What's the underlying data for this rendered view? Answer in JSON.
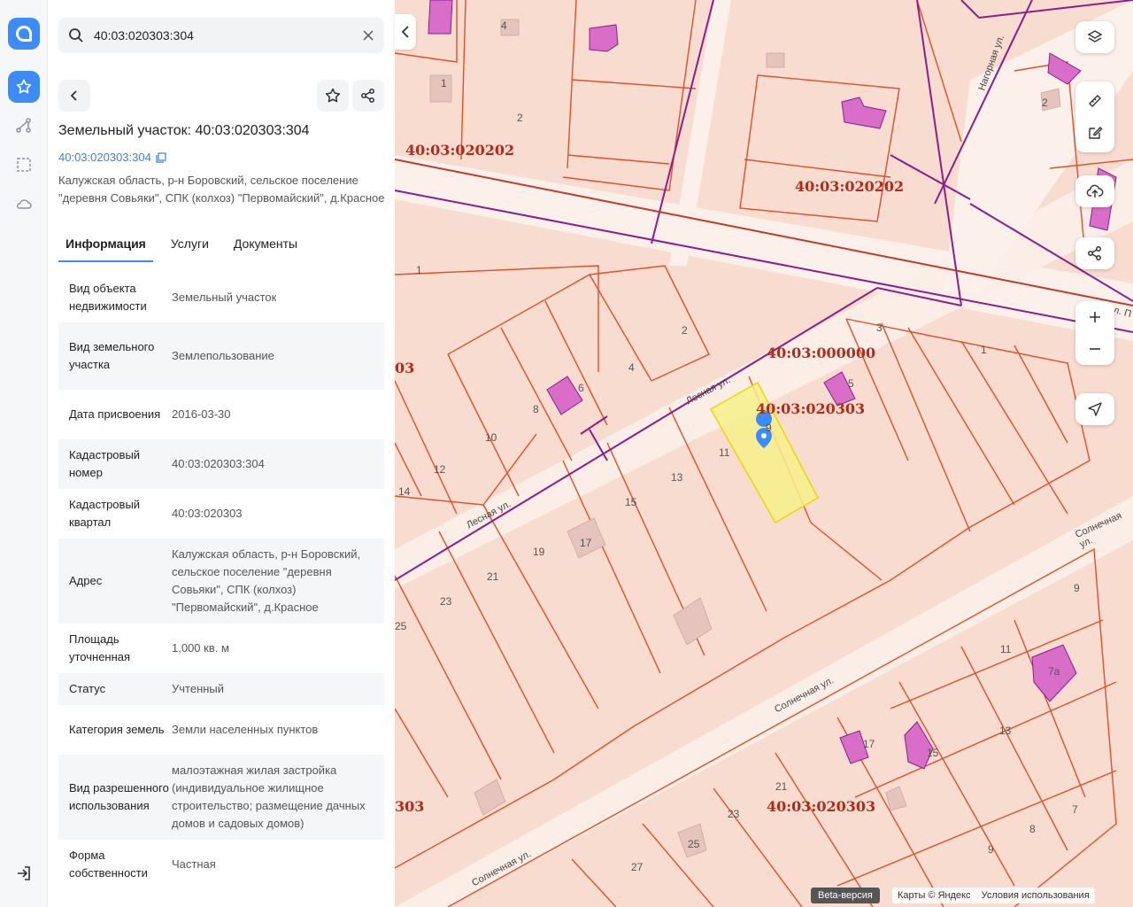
{
  "search": {
    "value": "40:03:020303:304"
  },
  "object": {
    "title": "Земельный участок: 40:03:020303:304",
    "cad_link": "40:03:020303:304",
    "address": "Калужская область, р-н Боровский, сельское поселение \"деревня Совьяки\", СПК (колхоз) \"Первомайский\", д.Красное"
  },
  "tabs": [
    "Информация",
    "Услуги",
    "Документы"
  ],
  "info": [
    {
      "k": "Вид объекта недвижимости",
      "v": "Земельный участок"
    },
    {
      "k": "Вид земельного участка",
      "v": "Землепользование"
    },
    {
      "k": "Дата присвоения",
      "v": "2016-03-30"
    },
    {
      "k": "Кадастровый номер",
      "v": "40:03:020303:304"
    },
    {
      "k": "Кадастровый квартал",
      "v": "40:03:020303"
    },
    {
      "k": "Адрес",
      "v": "Калужская область, р-н Боровский, сельское поселение \"деревня Совьяки\", СПК (колхоз) \"Первомайский\", д.Красное"
    },
    {
      "k": "Площадь уточненная",
      "v": "1,000 кв. м"
    },
    {
      "k": "Статус",
      "v": "Учтенный"
    },
    {
      "k": "Категория земель",
      "v": "Земли населенных пунктов"
    },
    {
      "k": "Вид разрешенного использования",
      "v": "малоэтажная жилая застройка (индивидуальное жилищное строительство; размещение дачных домов и садовых домов)"
    },
    {
      "k": "Форма собственности",
      "v": "Частная"
    }
  ],
  "map": {
    "quarter_labels": [
      "40:03:020202",
      "40:03:020202",
      "40:03:000000",
      "40:03:020303",
      "40:03:020303",
      "03",
      "303"
    ],
    "streets": [
      "Нагорная ул.",
      "Лесная ул.",
      "Лесная ул.",
      "Солнечная ул.",
      "Солнечная ул.",
      "Солнечная ул.",
      "л. П"
    ],
    "plot_numbers": [
      "4",
      "1",
      "2",
      "2",
      "1",
      "3",
      "1",
      "2",
      "4",
      "6",
      "8",
      "10",
      "12",
      "14",
      "5",
      "9",
      "11",
      "13",
      "15",
      "17",
      "19",
      "21",
      "23",
      "25",
      "27",
      "9",
      "11",
      "13",
      "7",
      "8",
      "9",
      "17",
      "15",
      "21",
      "23",
      "25",
      "7а"
    ],
    "footer": {
      "beta": "Beta-версия",
      "copyright": "Карты © Яндекс",
      "terms": "Условия использования"
    }
  },
  "colors": {
    "accent": "#3d8bf7",
    "selected_plot": "#f7f08a",
    "parcel_border": "#e0502a",
    "quarter_border": "#8b1e8b"
  }
}
